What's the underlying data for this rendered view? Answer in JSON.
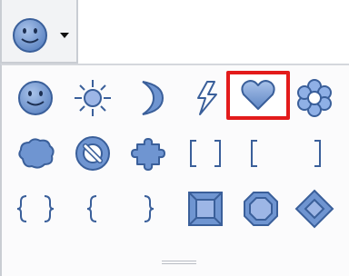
{
  "toolbar": {
    "current_shape_icon": "smiley-face-icon",
    "dropdown_icon": "chevron-down-icon"
  },
  "palette": {
    "selected": "heart",
    "rows": [
      [
        "smiley-face-icon",
        "sun-icon",
        "moon-icon",
        "lightning-bolt-icon",
        "heart-icon",
        "flower-icon"
      ],
      [
        "cloud-icon",
        "no-symbol-icon",
        "puzzle-icon",
        "double-bracket-icon",
        "left-bracket-icon",
        "right-bracket-icon"
      ],
      [
        "double-brace-icon",
        "left-brace-icon",
        "right-brace-icon",
        "square-bevel-icon",
        "octagon-bevel-icon",
        "diamond-bevel-icon"
      ]
    ]
  },
  "colors": {
    "shape_fill": "#6f95d1",
    "shape_stroke": "#3a5f9a",
    "highlight": "#e31b1b"
  }
}
